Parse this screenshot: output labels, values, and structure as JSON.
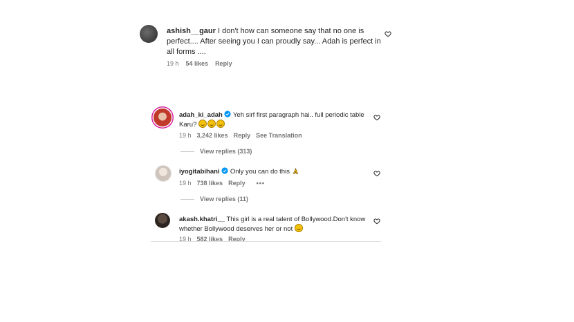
{
  "comments": [
    {
      "username": "ashish__gaur",
      "text": "I don't how can someone say that no one is perfect.... After seeing you I can proudly say... Adah is perfect in all forms ....",
      "time": "19 h",
      "likes": "54 likes",
      "reply": "Reply"
    },
    {
      "username": "adah_ki_adah",
      "verified": true,
      "text": "Yeh sirf first paragraph hai.. full periodic table Karu?",
      "time": "19 h",
      "likes": "3,242 likes",
      "reply": "Reply",
      "translation": "See Translation",
      "view_replies": "View replies (313)"
    },
    {
      "username": "iyogitabihani",
      "verified": true,
      "text": "Only you can do this",
      "time": "19 h",
      "likes": "738 likes",
      "reply": "Reply",
      "more": "•••",
      "view_replies": "View replies (11)"
    },
    {
      "username": "akash.khatri__",
      "text": "This girl is a real talent of Bollywood.Don't know whether Bollywood deserves her or not",
      "time": "19 h",
      "likes": "582 likes",
      "reply": "Reply"
    }
  ],
  "colors": {
    "verified": "#0095f6",
    "meta_text": "#737373",
    "text": "#262626"
  },
  "icons": [
    "heart-icon",
    "verified-badge-icon",
    "grin-emoji",
    "folded-hands-emoji",
    "smile-emoji"
  ]
}
